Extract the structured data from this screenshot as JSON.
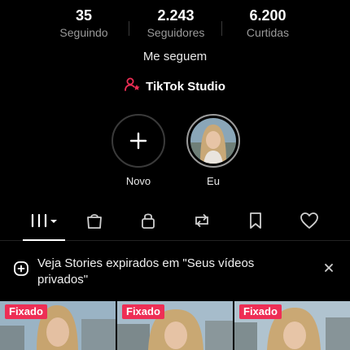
{
  "stats": {
    "following": {
      "value": "35",
      "label": "Seguindo"
    },
    "followers": {
      "value": "2.243",
      "label": "Seguidores"
    },
    "likes": {
      "value": "6.200",
      "label": "Curtidas"
    }
  },
  "follow_back_label": "Me seguem",
  "studio_label": "TikTok Studio",
  "stories": {
    "new_label": "Novo",
    "me_label": "Eu"
  },
  "tabs": [
    {
      "name": "videos",
      "icon": "grid-icon"
    },
    {
      "name": "shop",
      "icon": "bag-icon"
    },
    {
      "name": "private",
      "icon": "lock-icon"
    },
    {
      "name": "reposts",
      "icon": "repost-icon"
    },
    {
      "name": "favorites",
      "icon": "bookmark-icon"
    },
    {
      "name": "liked",
      "icon": "heart-icon"
    }
  ],
  "banner": {
    "text": "Veja Stories expirados em \"Seus vídeos privados\""
  },
  "videos": [
    {
      "badge": "Fixado"
    },
    {
      "badge": "Fixado"
    },
    {
      "badge": "Fixado"
    }
  ],
  "colors": {
    "accent": "#ee2e55",
    "background": "#000000",
    "muted_text": "#9a9a9a"
  }
}
